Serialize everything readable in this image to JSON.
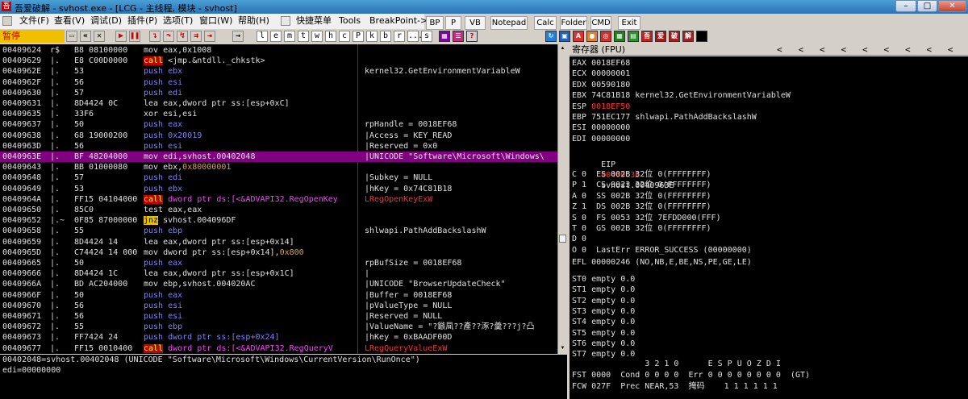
{
  "window": {
    "title": "吾爱破解 - svhost.exe - [LCG - 主线程, 模块 - svhost]",
    "minimize": "–",
    "maximize": "□",
    "close": "✕"
  },
  "menu": [
    {
      "label": "文件(F)",
      "icon": "file-icon"
    },
    {
      "label": "查看(V)"
    },
    {
      "label": "调试(D)"
    },
    {
      "label": "插件(P)"
    },
    {
      "label": "选项(T)"
    },
    {
      "label": "窗口(W)"
    },
    {
      "label": "帮助(H)"
    },
    {
      "label": "快捷菜单",
      "icon": "quick-menu-icon"
    },
    {
      "label": "Tools"
    },
    {
      "label": "BreakPoint->"
    }
  ],
  "quick_buttons": [
    "BP",
    "P",
    "VB",
    "Notepad",
    "Calc",
    "Folder",
    "CMD",
    "Exit"
  ],
  "toolbar": {
    "status": "暂停",
    "letters": [
      "l",
      "e",
      "m",
      "t",
      "w",
      "h",
      "c",
      "P",
      "k",
      "b",
      "r",
      "...",
      "s"
    ],
    "icons": [
      "open-icon",
      "restart-icon",
      "close-icon",
      "run-icon",
      "pause-icon",
      "step-into-icon",
      "step-over-icon",
      "trace-into-icon",
      "trace-over-icon",
      "execute-till-return-icon",
      "goto-icon"
    ]
  },
  "cpu": {
    "rows": [
      {
        "addr": "00409624",
        "mark": "r$",
        "hex": "B8 08100000",
        "ins": [
          {
            "t": "mov eax,0x1008",
            "c": ""
          }
        ],
        "cm": ""
      },
      {
        "addr": "00409629",
        "mark": "|.",
        "hex": "E8 C00D0000",
        "ins": [
          {
            "t": "call",
            "c": "call"
          },
          {
            "t": " <jmp.&ntdll._chkstk>",
            "c": ""
          }
        ],
        "cm": ""
      },
      {
        "addr": "0040962E",
        "mark": "|.",
        "hex": "53",
        "ins": [
          {
            "t": "push ebx",
            "c": "push"
          }
        ],
        "cm": "kernel32.GetEnvironmentVariableW"
      },
      {
        "addr": "0040962F",
        "mark": "|.",
        "hex": "56",
        "ins": [
          {
            "t": "push esi",
            "c": "push"
          }
        ],
        "cm": ""
      },
      {
        "addr": "00409630",
        "mark": "|.",
        "hex": "57",
        "ins": [
          {
            "t": "push edi",
            "c": "push"
          }
        ],
        "cm": ""
      },
      {
        "addr": "00409631",
        "mark": "|.",
        "hex": "8D4424 0C",
        "ins": [
          {
            "t": "lea eax,dword ptr ss:[esp+0xC]",
            "c": ""
          }
        ],
        "cm": ""
      },
      {
        "addr": "00409635",
        "mark": "|.",
        "hex": "33F6",
        "ins": [
          {
            "t": "xor esi,esi",
            "c": ""
          }
        ],
        "cm": ""
      },
      {
        "addr": "00409637",
        "mark": "|.",
        "hex": "50",
        "ins": [
          {
            "t": "push eax",
            "c": "push"
          }
        ],
        "cm": "rpHandle = 0018EF68"
      },
      {
        "addr": "00409638",
        "mark": "|.",
        "hex": "68 19000200",
        "ins": [
          {
            "t": "push 0x20019",
            "c": "push"
          }
        ],
        "cm": "|Access = KEY_READ"
      },
      {
        "addr": "0040963D",
        "mark": "|.",
        "hex": "56",
        "ins": [
          {
            "t": "push esi",
            "c": "push"
          }
        ],
        "cm": "|Reserved = 0x0"
      },
      {
        "addr": "0040963E",
        "mark": "|.",
        "hex": "BF 48204000",
        "ins": [
          {
            "t": "mov edi,svhost.00402048",
            "c": ""
          }
        ],
        "cm": "|UNICODE \"Software\\Microsoft\\Windows\\",
        "sel": true
      },
      {
        "addr": "00409643",
        "mark": "|.",
        "hex": "BB 01000080",
        "ins": [
          {
            "t": "mov ebx,",
            "c": ""
          },
          {
            "t": "0x80000001",
            "c": "ora"
          }
        ],
        "cm": ""
      },
      {
        "addr": "00409648",
        "mark": "|.",
        "hex": "57",
        "ins": [
          {
            "t": "push edi",
            "c": "push"
          }
        ],
        "cm": "|Subkey = NULL"
      },
      {
        "addr": "00409649",
        "mark": "|.",
        "hex": "53",
        "ins": [
          {
            "t": "push ebx",
            "c": "push"
          }
        ],
        "cm": "|hKey = 0x74C81B18"
      },
      {
        "addr": "0040964A",
        "mark": "|.",
        "hex": "FF15 04104000",
        "ins": [
          {
            "t": "call",
            "c": "call"
          },
          {
            "t": " dword ptr ds:[<&ADVAPI32.RegOpenKey",
            "c": "mag"
          }
        ],
        "cm": "LRegOpenKeyExW",
        "cmc": "red"
      },
      {
        "addr": "00409650",
        "mark": "|.",
        "hex": "85C0",
        "ins": [
          {
            "t": "test eax,eax",
            "c": ""
          }
        ],
        "cm": ""
      },
      {
        "addr": "00409652",
        "mark": "|.~",
        "hex": "0F85 87000000",
        "ins": [
          {
            "t": "jnz",
            "c": "jmp"
          },
          {
            "t": " svhost.004096DF",
            "c": ""
          }
        ],
        "cm": ""
      },
      {
        "addr": "00409658",
        "mark": "|.",
        "hex": "55",
        "ins": [
          {
            "t": "push ebp",
            "c": "push"
          }
        ],
        "cm": "shlwapi.PathAddBackslashW"
      },
      {
        "addr": "00409659",
        "mark": "|.",
        "hex": "8D4424 14",
        "ins": [
          {
            "t": "lea eax,dword ptr ss:[esp+0x14]",
            "c": ""
          }
        ],
        "cm": ""
      },
      {
        "addr": "0040965D",
        "mark": "|.",
        "hex": "C74424 14 000",
        "ins": [
          {
            "t": "mov dword ptr ss:[esp+0x14],",
            "c": ""
          },
          {
            "t": "0x800",
            "c": "ora"
          }
        ],
        "cm": ""
      },
      {
        "addr": "00409665",
        "mark": "|.",
        "hex": "50",
        "ins": [
          {
            "t": "push eax",
            "c": "push"
          }
        ],
        "cm": "rpBufSize = 0018EF68"
      },
      {
        "addr": "00409666",
        "mark": "|.",
        "hex": "8D4424 1C",
        "ins": [
          {
            "t": "lea eax,dword ptr ss:[esp+0x1C]",
            "c": ""
          }
        ],
        "cm": "|"
      },
      {
        "addr": "0040966A",
        "mark": "|.",
        "hex": "BD AC204000",
        "ins": [
          {
            "t": "mov ebp,svhost.004020AC",
            "c": ""
          }
        ],
        "cm": "|UNICODE \"BrowserUpdateCheck\""
      },
      {
        "addr": "0040966F",
        "mark": "|.",
        "hex": "50",
        "ins": [
          {
            "t": "push eax",
            "c": "push"
          }
        ],
        "cm": "|Buffer = 0018EF68"
      },
      {
        "addr": "00409670",
        "mark": "|.",
        "hex": "56",
        "ins": [
          {
            "t": "push esi",
            "c": "push"
          }
        ],
        "cm": "|pValueType = NULL"
      },
      {
        "addr": "00409671",
        "mark": "|.",
        "hex": "56",
        "ins": [
          {
            "t": "push esi",
            "c": "push"
          }
        ],
        "cm": "|Reserved = NULL"
      },
      {
        "addr": "00409672",
        "mark": "|.",
        "hex": "55",
        "ins": [
          {
            "t": "push ebp",
            "c": "push"
          }
        ],
        "cm": "|ValueName = \"?鏃凬??產??涿?羹???j?凸"
      },
      {
        "addr": "00409673",
        "mark": "|.",
        "hex": "FF7424 24",
        "ins": [
          {
            "t": "push dword ptr ss:[esp+0x24]",
            "c": "push"
          }
        ],
        "cm": "|hKey = 0xBAADF00D"
      },
      {
        "addr": "00409677",
        "mark": "|.",
        "hex": "FF15 0010400",
        "ins": [
          {
            "t": "call",
            "c": "call"
          },
          {
            "t": " dword ptr ds:[<&ADVAPI32.RegQueryV",
            "c": "mag"
          }
        ],
        "cm": "LRegQueryValueExW",
        "cmc": "red"
      }
    ]
  },
  "info": {
    "line1": "00402048=svhost.00402048 (UNICODE \"Software\\Microsoft\\Windows\\CurrentVersion\\RunOnce\")",
    "line2": "edi=00000000"
  },
  "registers": {
    "title": "寄存器 (FPU)",
    "arrows": "<   <   <   <   <   <   <   <   <",
    "gp": [
      {
        "name": "EAX",
        "val": "0018EF68",
        "note": "",
        "red": false
      },
      {
        "name": "ECX",
        "val": "00000001",
        "note": "",
        "red": false
      },
      {
        "name": "EDX",
        "val": "00590180",
        "note": "",
        "red": false
      },
      {
        "name": "EBX",
        "val": "74C81B18",
        "note": "kernel32.GetEnvironmentVariableW",
        "red": false
      },
      {
        "name": "ESP",
        "val": "0018EF50",
        "note": "",
        "red": true
      },
      {
        "name": "EBP",
        "val": "751EC177",
        "note": "shlwapi.PathAddBackslashW",
        "red": false
      },
      {
        "name": "ESI",
        "val": "00000000",
        "note": "",
        "red": false
      },
      {
        "name": "EDI",
        "val": "00000000",
        "note": "",
        "red": false
      }
    ],
    "eip": {
      "name": "EIP",
      "val": "0040963E",
      "note": "svhost.0040963E"
    },
    "flags": [
      "C 0  ES 002B 32位 0(FFFFFFFF)",
      "P 1  CS 0023 32位 0(FFFFFFFF)",
      "A 0  SS 002B 32位 0(FFFFFFFF)",
      "Z 1  DS 002B 32位 0(FFFFFFFF)",
      "S 0  FS 0053 32位 7EFDD000(FFF)",
      "T 0  GS 002B 32位 0(FFFFFFFF)",
      "D 0",
      "O 0  LastErr ERROR_SUCCESS (00000000)"
    ],
    "efl": "EFL 00000246 (NO,NB,E,BE,NS,PE,GE,LE)",
    "st": [
      "ST0 empty 0.0",
      "ST1 empty 0.0",
      "ST2 empty 0.0",
      "ST3 empty 0.0",
      "ST4 empty 0.0",
      "ST5 empty 0.0",
      "ST6 empty 0.0",
      "ST7 empty 0.0"
    ],
    "fpu_header": "               3 2 1 0      E S P U O Z D I",
    "fst": "FST 0000  Cond 0 0 0 0  Err 0 0 0 0 0 0 0 0  (GT)",
    "fcw": "FCW 027F  Prec NEAR,53  掩码    1 1 1 1 1 1"
  }
}
